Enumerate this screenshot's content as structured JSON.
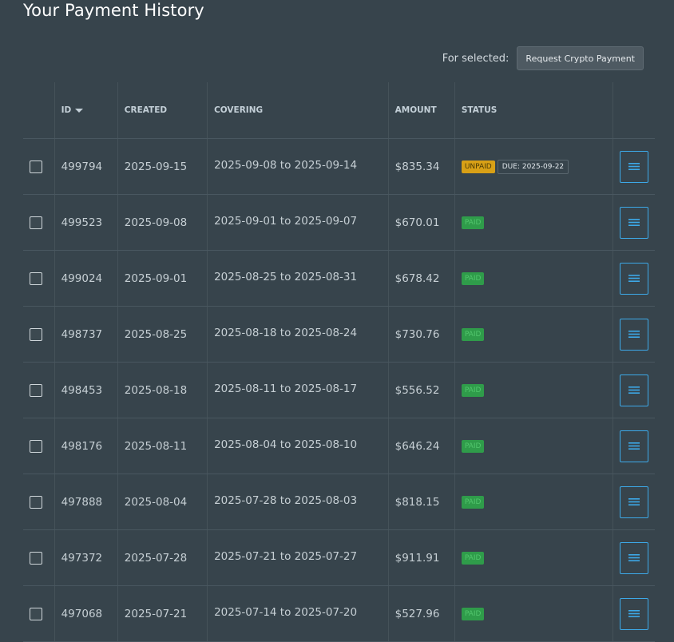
{
  "page": {
    "title": "Your Payment History"
  },
  "bulk": {
    "label": "For selected:",
    "button": "Request Crypto Payment"
  },
  "table": {
    "headers": {
      "id": "ID",
      "created": "CREATED",
      "covering": "COVERING",
      "amount": "AMOUNT",
      "status": "STATUS"
    },
    "rows": [
      {
        "id": "499794",
        "created": "2025-09-15",
        "covering": "2025-09-08 to 2025-09-14",
        "amount": "$835.34",
        "status": "UNPAID",
        "due": "DUE: 2025-09-22"
      },
      {
        "id": "499523",
        "created": "2025-09-08",
        "covering": "2025-09-01 to 2025-09-07",
        "amount": "$670.01",
        "status": "PAID"
      },
      {
        "id": "499024",
        "created": "2025-09-01",
        "covering": "2025-08-25 to 2025-08-31",
        "amount": "$678.42",
        "status": "PAID"
      },
      {
        "id": "498737",
        "created": "2025-08-25",
        "covering": "2025-08-18 to 2025-08-24",
        "amount": "$730.76",
        "status": "PAID"
      },
      {
        "id": "498453",
        "created": "2025-08-18",
        "covering": "2025-08-11 to 2025-08-17",
        "amount": "$556.52",
        "status": "PAID"
      },
      {
        "id": "498176",
        "created": "2025-08-11",
        "covering": "2025-08-04 to 2025-08-10",
        "amount": "$646.24",
        "status": "PAID"
      },
      {
        "id": "497888",
        "created": "2025-08-04",
        "covering": "2025-07-28 to 2025-08-03",
        "amount": "$818.15",
        "status": "PAID"
      },
      {
        "id": "497372",
        "created": "2025-07-28",
        "covering": "2025-07-21 to 2025-07-27",
        "amount": "$911.91",
        "status": "PAID"
      },
      {
        "id": "497068",
        "created": "2025-07-21",
        "covering": "2025-07-14 to 2025-07-20",
        "amount": "$527.96",
        "status": "PAID"
      }
    ]
  },
  "icons": {
    "sort": "caret-down-icon",
    "row_action": "hamburger-menu-icon",
    "select": "checkbox"
  },
  "colors": {
    "background": "#37444c",
    "unpaid": "#d8a016",
    "paid": "#2f9c4a",
    "action_accent": "#3da9e8"
  }
}
